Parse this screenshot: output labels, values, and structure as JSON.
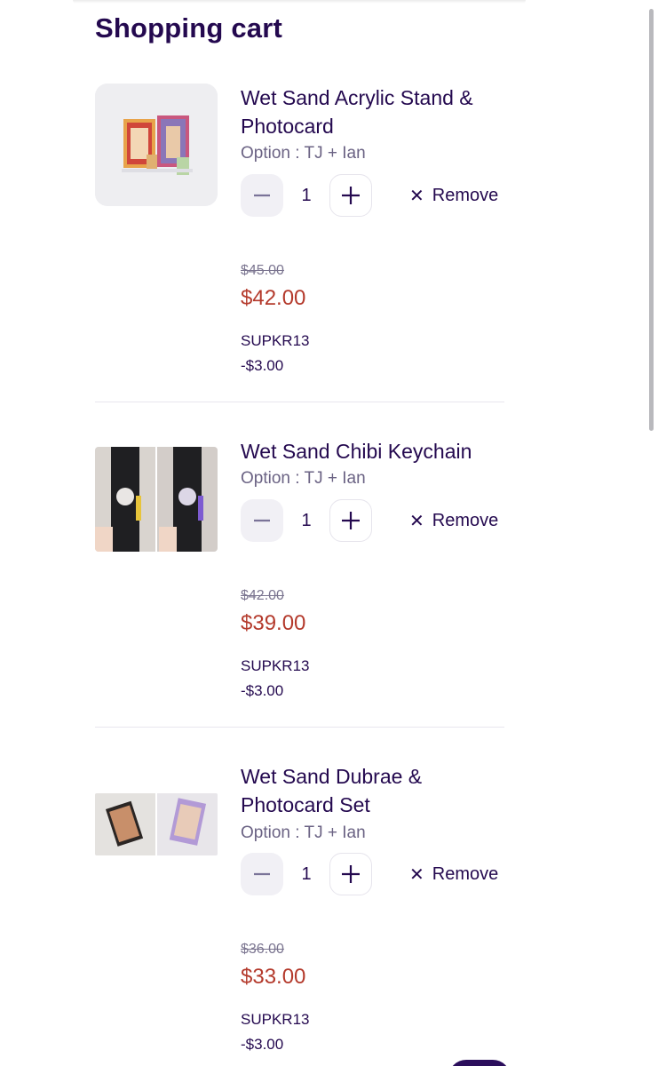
{
  "page": {
    "title": "Shopping cart"
  },
  "cart": {
    "items": [
      {
        "name": "Wet Sand Acrylic Stand & Photocard",
        "option": "Option : TJ + Ian",
        "quantity": "1",
        "remove_label": "Remove",
        "original_price": "$45.00",
        "price": "$42.00",
        "promo_code": "SUPKR13",
        "promo_discount": "-$3.00"
      },
      {
        "name": "Wet Sand Chibi Keychain",
        "option": "Option : TJ + Ian",
        "quantity": "1",
        "remove_label": "Remove",
        "original_price": "$42.00",
        "price": "$39.00",
        "promo_code": "SUPKR13",
        "promo_discount": "-$3.00"
      },
      {
        "name": "Wet Sand Dubrae & Photocard Set",
        "option": "Option : TJ + Ian",
        "quantity": "1",
        "remove_label": "Remove",
        "original_price": "$36.00",
        "price": "$33.00",
        "promo_code": "SUPKR13",
        "promo_discount": "-$3.00"
      }
    ]
  },
  "colors": {
    "title": "#24094f",
    "sale_price": "#b43a2c",
    "muted": "#6b6384"
  }
}
